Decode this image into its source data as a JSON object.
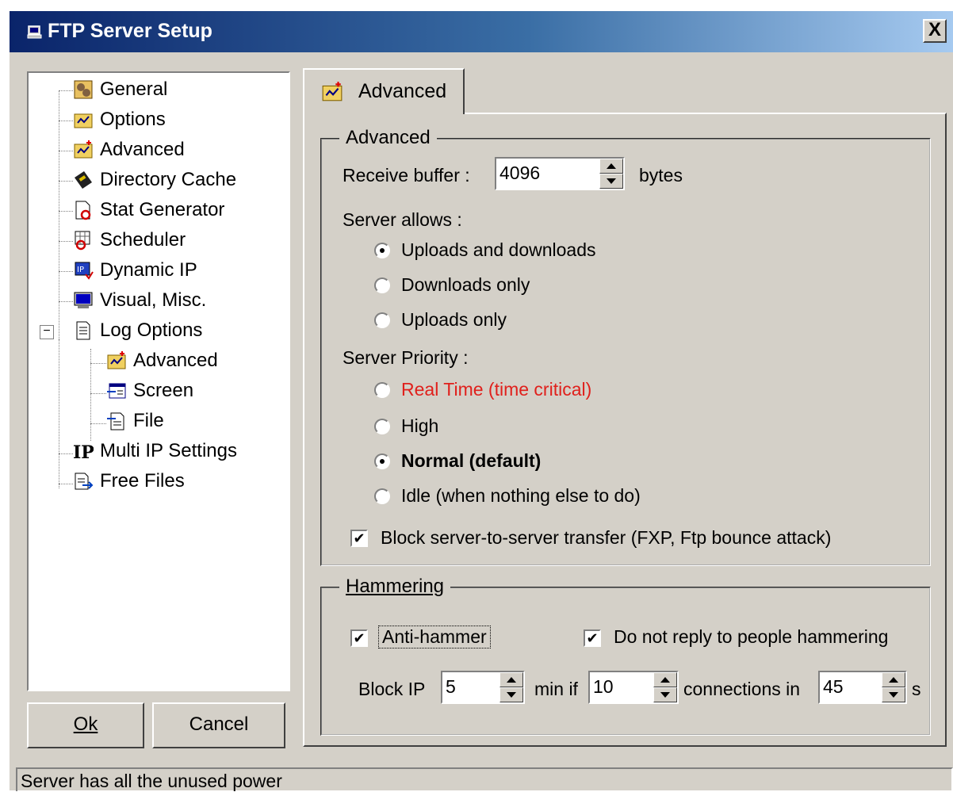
{
  "window": {
    "title": "FTP Server Setup",
    "close_label": "X"
  },
  "tree": {
    "items": [
      {
        "label": "General",
        "icon": "general-icon"
      },
      {
        "label": "Options",
        "icon": "options-icon"
      },
      {
        "label": "Advanced",
        "icon": "advanced-icon"
      },
      {
        "label": "Directory Cache",
        "icon": "directory-cache-icon"
      },
      {
        "label": "Stat Generator",
        "icon": "stat-generator-icon"
      },
      {
        "label": "Scheduler",
        "icon": "scheduler-icon"
      },
      {
        "label": "Dynamic IP",
        "icon": "dynamic-ip-icon"
      },
      {
        "label": "Visual, Misc.",
        "icon": "monitor-icon"
      },
      {
        "label": "Log Options",
        "icon": "log-options-icon",
        "expander": "−"
      },
      {
        "label": "Advanced",
        "icon": "advanced-icon"
      },
      {
        "label": "Screen",
        "icon": "screen-icon"
      },
      {
        "label": "File",
        "icon": "file-icon"
      },
      {
        "label": "Multi IP Settings",
        "icon": "multi-ip-icon"
      },
      {
        "label": "Free Files",
        "icon": "free-files-icon"
      }
    ]
  },
  "buttons": {
    "ok_label": "Ok",
    "cancel_label": "Cancel"
  },
  "tab": {
    "label": "Advanced"
  },
  "advanced": {
    "group_title": "Advanced",
    "receive_buffer_label": "Receive buffer :",
    "receive_buffer_value": "4096",
    "receive_buffer_unit": "bytes",
    "server_allows_label": "Server allows :",
    "server_allows_options": [
      {
        "label": "Uploads and downloads",
        "selected": true
      },
      {
        "label": "Downloads only",
        "selected": false
      },
      {
        "label": "Uploads only",
        "selected": false
      }
    ],
    "server_priority_label": "Server Priority :",
    "server_priority_options": [
      {
        "label": "Real Time (time critical)",
        "selected": false,
        "color": "#e0201c"
      },
      {
        "label": "High",
        "selected": false
      },
      {
        "label": "Normal (default)",
        "selected": true
      },
      {
        "label": "Idle (when nothing else to do)",
        "selected": false
      }
    ],
    "block_fxp_label": "Block server-to-server transfer (FXP, Ftp bounce attack)",
    "block_fxp_checked": true
  },
  "hammering": {
    "group_title": "Hammering",
    "anti_hammer_label": "Anti-hammer",
    "anti_hammer_checked": true,
    "no_reply_label": "Do not reply to people hammering",
    "no_reply_checked": true,
    "block_ip_label": "Block IP",
    "block_ip_minutes": "5",
    "min_if_label": "min if",
    "connections_value": "10",
    "connections_in_label": "connections in",
    "seconds_value": "45",
    "seconds_label": "s"
  },
  "status": {
    "text": "Server has all the unused power"
  },
  "colors": {
    "titlebar_start": "#0a246a",
    "titlebar_end": "#a6caf0",
    "face": "#d4d0c8"
  }
}
